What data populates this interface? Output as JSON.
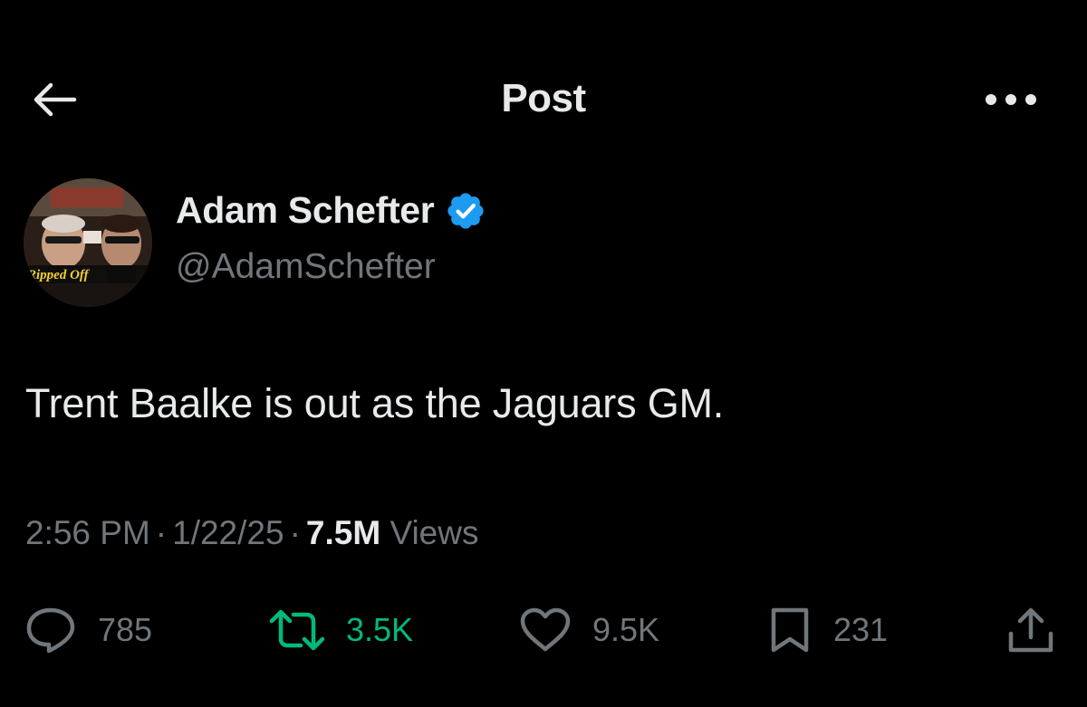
{
  "header": {
    "title": "Post",
    "back_icon": "arrow-left-icon",
    "more_icon": "more-horizontal-icon"
  },
  "author": {
    "name": "Adam Schefter",
    "handle": "@AdamSchefter",
    "verified": true,
    "verified_color": "#1d9bf0",
    "avatar_caption": "Ripped Off"
  },
  "tweet": {
    "text": "Trent Baalke is out as the Jaguars GM."
  },
  "meta": {
    "time": "2:56 PM",
    "date": "1/22/25",
    "views_count": "7.5M",
    "views_label": "Views"
  },
  "actions": {
    "replies": "785",
    "reposts": "3.5K",
    "likes": "9.5K",
    "bookmarks": "231",
    "repost_color": "#00ba7c",
    "icon_color": "#71767b"
  }
}
